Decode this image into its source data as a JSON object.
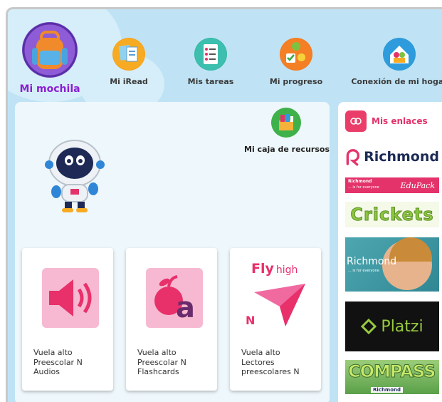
{
  "nav": {
    "mochila": "Mi mochila",
    "iread": "Mi iRead",
    "tareas": "Mis tareas",
    "progreso": "Mi progreso",
    "hogar": "Conexión de mi hogar"
  },
  "main": {
    "caja_label": "Mi caja de recursos",
    "cards": [
      {
        "lines": [
          "Vuela alto",
          "Preescolar N",
          "Audios"
        ]
      },
      {
        "lines": [
          "Vuela alto",
          "Preescolar N",
          "Flashcards"
        ]
      },
      {
        "lines": [
          "Vuela alto",
          "Lectores",
          "preescolares N"
        ]
      }
    ],
    "fly_high_1": "Fly",
    "fly_high_2": "high",
    "fly_letter": "N",
    "flash_letter": "a"
  },
  "links": {
    "title": "Mis enlaces",
    "richmond": "Richmond",
    "edupack_brand": "Richmond",
    "edupack_tag": "... is for everyone",
    "edupack_name": "EduPack",
    "crickets": "Crickets",
    "richmond_photo": "Richmond",
    "richmond_photo_tag": "... is for everyone",
    "platzi": "Platzi",
    "compass": "COMPASS",
    "compass_brand": "Richmond"
  },
  "colors": {
    "accent_purple": "#8a1fd0",
    "links_pink": "#e4336a",
    "sky": "#bfe3f5"
  }
}
